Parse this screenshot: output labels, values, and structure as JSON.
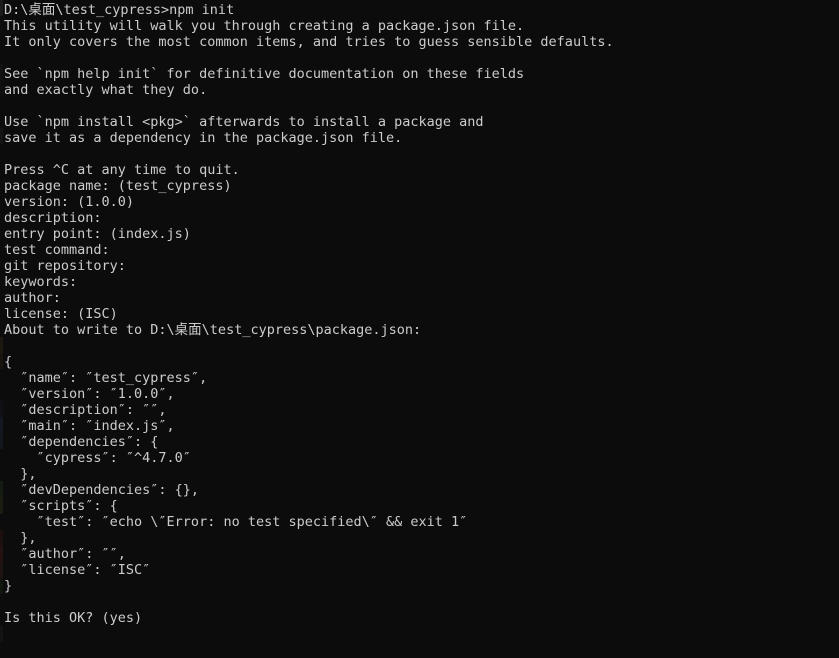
{
  "terminal": {
    "shell": "windows-command-prompt",
    "background_color": "#0c0c0c",
    "foreground_color": "#cccccc",
    "prompt_path": "D:\\桌面\\test_cypress",
    "command": "npm init",
    "cursor_row_label": "Is this OK? (yes)"
  },
  "lines": [
    "D:\\桌面\\test_cypress>npm init",
    "This utility will walk you through creating a package.json file.",
    "It only covers the most common items, and tries to guess sensible defaults.",
    "",
    "See `npm help init` for definitive documentation on these fields",
    "and exactly what they do.",
    "",
    "Use `npm install <pkg>` afterwards to install a package and",
    "save it as a dependency in the package.json file.",
    "",
    "Press ^C at any time to quit.",
    "package name: (test_cypress)",
    "version: (1.0.0)",
    "description:",
    "entry point: (index.js)",
    "test command:",
    "git repository:",
    "keywords:",
    "author:",
    "license: (ISC)",
    "About to write to D:\\桌面\\test_cypress\\package.json:",
    "",
    "{",
    "  ″name″: ″test_cypress″,",
    "  ″version″: ″1.0.0″,",
    "  ″description″: ″″,",
    "  ″main″: ″index.js″,",
    "  ″dependencies″: {",
    "    ″cypress″: ″^4.7.0″",
    "  },",
    "  ″devDependencies″: {},",
    "  ″scripts″: {",
    "    ″test″: ″echo \\″Error: no test specified\\″ && exit 1″",
    "  },",
    "  ″author″: ″″,",
    "  ″license″: ″ISC″",
    "}",
    "",
    "Is this OK? (yes)"
  ],
  "package_json": {
    "name": "test_cypress",
    "version": "1.0.0",
    "description": "",
    "main": "index.js",
    "dependencies": {
      "cypress": "^4.7.0"
    },
    "devDependencies": {},
    "scripts": {
      "test": "echo \\\"Error: no test specified\\\" && exit 1"
    },
    "author": "",
    "license": "ISC"
  },
  "prompts": [
    {
      "label": "package name:",
      "default": "(test_cypress)"
    },
    {
      "label": "version:",
      "default": "(1.0.0)"
    },
    {
      "label": "description:",
      "default": ""
    },
    {
      "label": "entry point:",
      "default": "(index.js)"
    },
    {
      "label": "test command:",
      "default": ""
    },
    {
      "label": "git repository:",
      "default": ""
    },
    {
      "label": "keywords:",
      "default": ""
    },
    {
      "label": "author:",
      "default": ""
    },
    {
      "label": "license:",
      "default": "(ISC)"
    },
    {
      "label": "Is this OK?",
      "default": "(yes)"
    }
  ],
  "edge_artifact_colors": [
    "#2a2a26",
    "#11110f",
    "#0c0c0c",
    "#0c0c0c",
    "#16181a",
    "#0e1012",
    "#0c0c0c",
    "#0c0c0c",
    "#1a1c1e",
    "#0c0c0c",
    "#0c0c0c",
    "#0c0c0c",
    "#0c0c0c",
    "#0c0c0c",
    "#0c0c0c",
    "#0c0c0c",
    "#0c0c0c",
    "#0c0c0c",
    "#0c0c0c",
    "#0c0c0c",
    "#0c0c0c",
    "#2b2414",
    "#221d10",
    "#0c0c0c",
    "#0c0c0c",
    "#12161f",
    "#1b2433",
    "#16202c",
    "#0c0c0c",
    "#0c0c0c",
    "#1d2a18",
    "#262d18",
    "#0c0c0c",
    "#2a1410",
    "#3a1612",
    "#2c1a14",
    "#14220f",
    "#0c0c0c",
    "#0c0c0c",
    "#1a1c1e",
    "#0c0c0c"
  ]
}
